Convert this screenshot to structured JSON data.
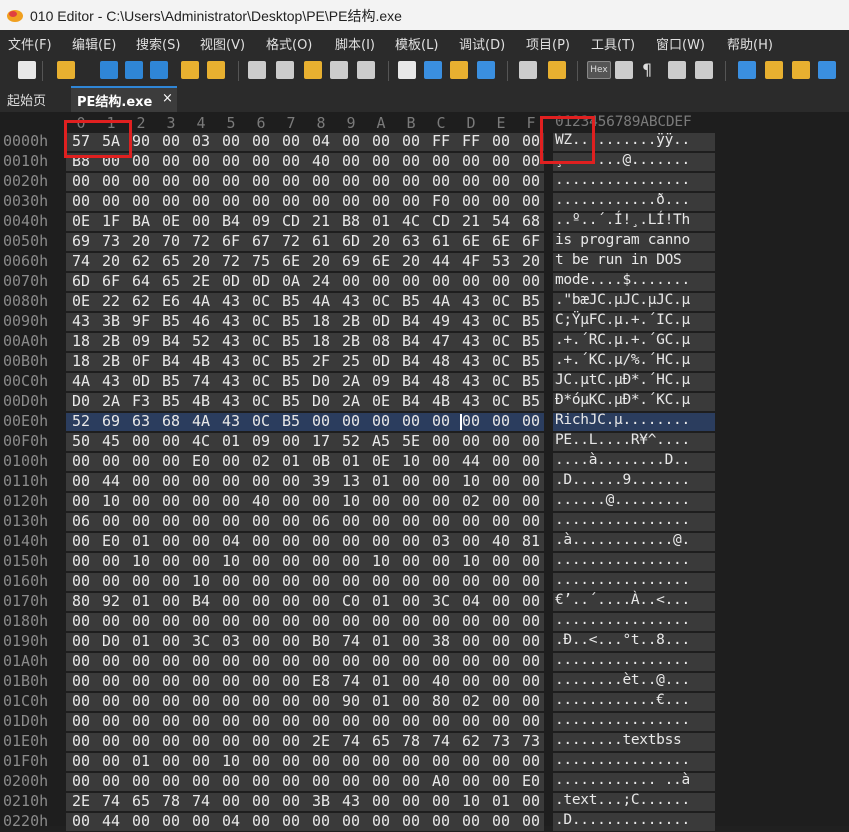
{
  "window": {
    "title": "010 Editor - C:\\Users\\Administrator\\Desktop\\PE\\PE结构.exe"
  },
  "menu": {
    "items": [
      {
        "label": "文件(F)"
      },
      {
        "label": "编辑(E)"
      },
      {
        "label": "搜索(S)"
      },
      {
        "label": "视图(V)"
      },
      {
        "label": "格式(O)"
      },
      {
        "label": "脚本(I)"
      },
      {
        "label": "模板(L)"
      },
      {
        "label": "调试(D)"
      },
      {
        "label": "项目(P)"
      },
      {
        "label": "工具(T)"
      },
      {
        "label": "窗口(W)"
      },
      {
        "label": "帮助(H)"
      }
    ]
  },
  "toolbar": {
    "buttons": [
      "new-file-icon",
      "open-folder-icon",
      "save-icon",
      "save-all-icon",
      "copy-window-icon",
      "open-folder2-icon",
      "open-multi-icon",
      "cut-icon",
      "copy-icon",
      "paste-icon",
      "undo-icon",
      "redo-icon",
      "find-icon",
      "replace-icon",
      "find-in-files-icon",
      "goto-icon",
      "compare-icon",
      "bookmark-icon",
      "hex-view-icon",
      "text-format-icon",
      "pilcrow-icon",
      "columns-icon",
      "highlight-icon",
      "calculator-icon",
      "template-icon",
      "convert-icon",
      "histogram-icon"
    ],
    "hex_label": "Hex",
    "pilcrow": "¶"
  },
  "tabs": {
    "home": "起始页",
    "active": "PE结构.exe",
    "close": "×"
  },
  "hex_header": {
    "columns": [
      "0",
      "1",
      "2",
      "3",
      "4",
      "5",
      "6",
      "7",
      "8",
      "9",
      "A",
      "B",
      "C",
      "D",
      "E",
      "F"
    ],
    "ascii": "0123456789ABCDEF"
  },
  "rows": [
    {
      "off": "0000h",
      "hex": [
        "57",
        "5A",
        "90",
        "00",
        "03",
        "00",
        "00",
        "00",
        "04",
        "00",
        "00",
        "00",
        "FF",
        "FF",
        "00",
        "00"
      ],
      "ascii": "WZ..........ÿÿ.."
    },
    {
      "off": "0010h",
      "hex": [
        "B8",
        "00",
        "00",
        "00",
        "00",
        "00",
        "00",
        "00",
        "40",
        "00",
        "00",
        "00",
        "00",
        "00",
        "00",
        "00"
      ],
      "ascii": "¸.......@......."
    },
    {
      "off": "0020h",
      "hex": [
        "00",
        "00",
        "00",
        "00",
        "00",
        "00",
        "00",
        "00",
        "00",
        "00",
        "00",
        "00",
        "00",
        "00",
        "00",
        "00"
      ],
      "ascii": "................"
    },
    {
      "off": "0030h",
      "hex": [
        "00",
        "00",
        "00",
        "00",
        "00",
        "00",
        "00",
        "00",
        "00",
        "00",
        "00",
        "00",
        "F0",
        "00",
        "00",
        "00"
      ],
      "ascii": "............ð..."
    },
    {
      "off": "0040h",
      "hex": [
        "0E",
        "1F",
        "BA",
        "0E",
        "00",
        "B4",
        "09",
        "CD",
        "21",
        "B8",
        "01",
        "4C",
        "CD",
        "21",
        "54",
        "68"
      ],
      "ascii": "..º..´.Í!¸.LÍ!Th"
    },
    {
      "off": "0050h",
      "hex": [
        "69",
        "73",
        "20",
        "70",
        "72",
        "6F",
        "67",
        "72",
        "61",
        "6D",
        "20",
        "63",
        "61",
        "6E",
        "6E",
        "6F"
      ],
      "ascii": "is program canno"
    },
    {
      "off": "0060h",
      "hex": [
        "74",
        "20",
        "62",
        "65",
        "20",
        "72",
        "75",
        "6E",
        "20",
        "69",
        "6E",
        "20",
        "44",
        "4F",
        "53",
        "20"
      ],
      "ascii": "t be run in DOS "
    },
    {
      "off": "0070h",
      "hex": [
        "6D",
        "6F",
        "64",
        "65",
        "2E",
        "0D",
        "0D",
        "0A",
        "24",
        "00",
        "00",
        "00",
        "00",
        "00",
        "00",
        "00"
      ],
      "ascii": "mode....$......."
    },
    {
      "off": "0080h",
      "hex": [
        "0E",
        "22",
        "62",
        "E6",
        "4A",
        "43",
        "0C",
        "B5",
        "4A",
        "43",
        "0C",
        "B5",
        "4A",
        "43",
        "0C",
        "B5"
      ],
      "ascii": ".\"bæJC.µJC.µJC.µ"
    },
    {
      "off": "0090h",
      "hex": [
        "43",
        "3B",
        "9F",
        "B5",
        "46",
        "43",
        "0C",
        "B5",
        "18",
        "2B",
        "0D",
        "B4",
        "49",
        "43",
        "0C",
        "B5"
      ],
      "ascii": "C;ŸµFC.µ.+.´IC.µ"
    },
    {
      "off": "00A0h",
      "hex": [
        "18",
        "2B",
        "09",
        "B4",
        "52",
        "43",
        "0C",
        "B5",
        "18",
        "2B",
        "08",
        "B4",
        "47",
        "43",
        "0C",
        "B5"
      ],
      "ascii": ".+.´RC.µ.+.´GC.µ"
    },
    {
      "off": "00B0h",
      "hex": [
        "18",
        "2B",
        "0F",
        "B4",
        "4B",
        "43",
        "0C",
        "B5",
        "2F",
        "25",
        "0D",
        "B4",
        "48",
        "43",
        "0C",
        "B5"
      ],
      "ascii": ".+.´KC.µ/%.´HC.µ"
    },
    {
      "off": "00C0h",
      "hex": [
        "4A",
        "43",
        "0D",
        "B5",
        "74",
        "43",
        "0C",
        "B5",
        "D0",
        "2A",
        "09",
        "B4",
        "48",
        "43",
        "0C",
        "B5"
      ],
      "ascii": "JC.µtC.µÐ*.´HC.µ"
    },
    {
      "off": "00D0h",
      "hex": [
        "D0",
        "2A",
        "F3",
        "B5",
        "4B",
        "43",
        "0C",
        "B5",
        "D0",
        "2A",
        "0E",
        "B4",
        "4B",
        "43",
        "0C",
        "B5"
      ],
      "ascii": "Ð*óµKC.µÐ*.´KC.µ"
    },
    {
      "off": "00E0h",
      "hex": [
        "52",
        "69",
        "63",
        "68",
        "4A",
        "43",
        "0C",
        "B5",
        "00",
        "00",
        "00",
        "00",
        "00",
        "00",
        "00",
        "00"
      ],
      "ascii": "RichJC.µ........"
    },
    {
      "off": "00F0h",
      "hex": [
        "50",
        "45",
        "00",
        "00",
        "4C",
        "01",
        "09",
        "00",
        "17",
        "52",
        "A5",
        "5E",
        "00",
        "00",
        "00",
        "00"
      ],
      "ascii": "PE..L....R¥^...."
    },
    {
      "off": "0100h",
      "hex": [
        "00",
        "00",
        "00",
        "00",
        "E0",
        "00",
        "02",
        "01",
        "0B",
        "01",
        "0E",
        "10",
        "00",
        "44",
        "00",
        "00"
      ],
      "ascii": "....à........D.."
    },
    {
      "off": "0110h",
      "hex": [
        "00",
        "44",
        "00",
        "00",
        "00",
        "00",
        "00",
        "00",
        "39",
        "13",
        "01",
        "00",
        "00",
        "10",
        "00",
        "00"
      ],
      "ascii": ".D......9......."
    },
    {
      "off": "0120h",
      "hex": [
        "00",
        "10",
        "00",
        "00",
        "00",
        "00",
        "40",
        "00",
        "00",
        "10",
        "00",
        "00",
        "00",
        "02",
        "00",
        "00"
      ],
      "ascii": "......@........."
    },
    {
      "off": "0130h",
      "hex": [
        "06",
        "00",
        "00",
        "00",
        "00",
        "00",
        "00",
        "00",
        "06",
        "00",
        "00",
        "00",
        "00",
        "00",
        "00",
        "00"
      ],
      "ascii": "................"
    },
    {
      "off": "0140h",
      "hex": [
        "00",
        "E0",
        "01",
        "00",
        "00",
        "04",
        "00",
        "00",
        "00",
        "00",
        "00",
        "00",
        "03",
        "00",
        "40",
        "81"
      ],
      "ascii": ".à............@."
    },
    {
      "off": "0150h",
      "hex": [
        "00",
        "00",
        "10",
        "00",
        "00",
        "10",
        "00",
        "00",
        "00",
        "00",
        "10",
        "00",
        "00",
        "10",
        "00",
        "00"
      ],
      "ascii": "................"
    },
    {
      "off": "0160h",
      "hex": [
        "00",
        "00",
        "00",
        "00",
        "10",
        "00",
        "00",
        "00",
        "00",
        "00",
        "00",
        "00",
        "00",
        "00",
        "00",
        "00"
      ],
      "ascii": "................"
    },
    {
      "off": "0170h",
      "hex": [
        "80",
        "92",
        "01",
        "00",
        "B4",
        "00",
        "00",
        "00",
        "00",
        "C0",
        "01",
        "00",
        "3C",
        "04",
        "00",
        "00"
      ],
      "ascii": "€’..´....À..<..."
    },
    {
      "off": "0180h",
      "hex": [
        "00",
        "00",
        "00",
        "00",
        "00",
        "00",
        "00",
        "00",
        "00",
        "00",
        "00",
        "00",
        "00",
        "00",
        "00",
        "00"
      ],
      "ascii": "................"
    },
    {
      "off": "0190h",
      "hex": [
        "00",
        "D0",
        "01",
        "00",
        "3C",
        "03",
        "00",
        "00",
        "B0",
        "74",
        "01",
        "00",
        "38",
        "00",
        "00",
        "00"
      ],
      "ascii": ".Ð..<...°t..8..."
    },
    {
      "off": "01A0h",
      "hex": [
        "00",
        "00",
        "00",
        "00",
        "00",
        "00",
        "00",
        "00",
        "00",
        "00",
        "00",
        "00",
        "00",
        "00",
        "00",
        "00"
      ],
      "ascii": "................"
    },
    {
      "off": "01B0h",
      "hex": [
        "00",
        "00",
        "00",
        "00",
        "00",
        "00",
        "00",
        "00",
        "E8",
        "74",
        "01",
        "00",
        "40",
        "00",
        "00",
        "00"
      ],
      "ascii": "........èt..@..."
    },
    {
      "off": "01C0h",
      "hex": [
        "00",
        "00",
        "00",
        "00",
        "00",
        "00",
        "00",
        "00",
        "00",
        "90",
        "01",
        "00",
        "80",
        "02",
        "00",
        "00"
      ],
      "ascii": "............€..."
    },
    {
      "off": "01D0h",
      "hex": [
        "00",
        "00",
        "00",
        "00",
        "00",
        "00",
        "00",
        "00",
        "00",
        "00",
        "00",
        "00",
        "00",
        "00",
        "00",
        "00"
      ],
      "ascii": "................"
    },
    {
      "off": "01E0h",
      "hex": [
        "00",
        "00",
        "00",
        "00",
        "00",
        "00",
        "00",
        "00",
        "2E",
        "74",
        "65",
        "78",
        "74",
        "62",
        "73",
        "73"
      ],
      "ascii": "........textbss"
    },
    {
      "off": "01F0h",
      "hex": [
        "00",
        "00",
        "01",
        "00",
        "00",
        "10",
        "00",
        "00",
        "00",
        "00",
        "00",
        "00",
        "00",
        "00",
        "00",
        "00"
      ],
      "ascii": "................"
    },
    {
      "off": "0200h",
      "hex": [
        "00",
        "00",
        "00",
        "00",
        "00",
        "00",
        "00",
        "00",
        "00",
        "00",
        "00",
        "00",
        "A0",
        "00",
        "00",
        "E0"
      ],
      "ascii": "............ ..à"
    },
    {
      "off": "0210h",
      "hex": [
        "2E",
        "74",
        "65",
        "78",
        "74",
        "00",
        "00",
        "00",
        "3B",
        "43",
        "00",
        "00",
        "00",
        "10",
        "01",
        "00"
      ],
      "ascii": ".text...;C......"
    },
    {
      "off": "0220h",
      "hex": [
        "00",
        "44",
        "00",
        "00",
        "00",
        "04",
        "00",
        "00",
        "00",
        "00",
        "00",
        "00",
        "00",
        "00",
        "00",
        "00"
      ],
      "ascii": ".D.............."
    }
  ],
  "colors": {
    "accent": "#2f86d6",
    "highlight": "#e02020",
    "selection": "#2b3d5e"
  }
}
